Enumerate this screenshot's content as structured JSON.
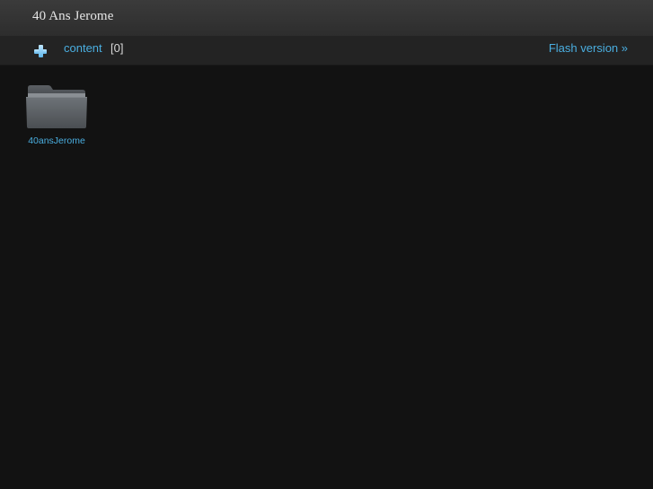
{
  "header": {
    "title": "40 Ans Jerome"
  },
  "nav": {
    "add_icon": "plus-icon",
    "content_label": "content",
    "content_count": "[0]",
    "flash_label": "Flash version »"
  },
  "gallery": {
    "folders": [
      {
        "name": "40ansJerome",
        "icon": "folder-icon"
      }
    ]
  },
  "colors": {
    "background": "#121212",
    "title_bar": "#333333",
    "nav_bar": "#232323",
    "link": "#4aaee0",
    "title_text": "#e6e6e6"
  }
}
